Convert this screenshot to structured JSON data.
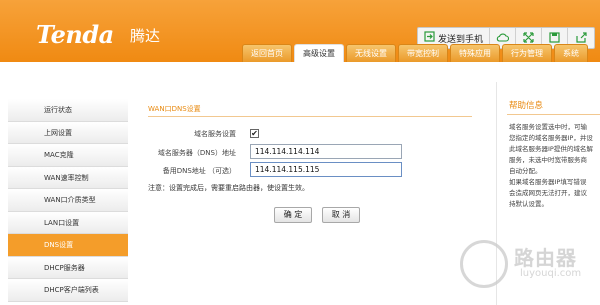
{
  "header": {
    "logo": "Tenda",
    "logo_cn": "腾达",
    "toolbar": {
      "send_label": "发送到手机",
      "icons": [
        "send-icon",
        "cloud-icon",
        "expand-icon",
        "save-icon",
        "share-icon"
      ]
    },
    "tabs": [
      {
        "label": "返回首页",
        "active": false
      },
      {
        "label": "高级设置",
        "active": true
      },
      {
        "label": "无线设置",
        "active": false
      },
      {
        "label": "带宽控制",
        "active": false
      },
      {
        "label": "特殊应用",
        "active": false
      },
      {
        "label": "行为管理",
        "active": false
      },
      {
        "label": "系统",
        "active": false
      }
    ]
  },
  "sidebar": {
    "items": [
      {
        "label": "运行状态"
      },
      {
        "label": "上网设置"
      },
      {
        "label": "MAC克隆"
      },
      {
        "label": "WAN速率控制"
      },
      {
        "label": "WAN口介质类型"
      },
      {
        "label": "LAN口设置"
      },
      {
        "label": "DNS设置",
        "active": true
      },
      {
        "label": "DHCP服务器"
      },
      {
        "label": "DHCP客户端列表"
      }
    ]
  },
  "main": {
    "title": "WAN口DNS设置",
    "rows": {
      "dns_service": {
        "label": "域名服务设置",
        "checked": "✔"
      },
      "primary": {
        "label": "域名服务器（DNS）地址",
        "value": "114.114.114.114"
      },
      "secondary": {
        "label": "备用DNS地址 （可选）",
        "value": "114.114.115.115"
      }
    },
    "note": "注意：设置完成后，需要重启路由器，使设置生效。",
    "ok_label": "确 定",
    "cancel_label": "取 消"
  },
  "help": {
    "title": "帮助信息",
    "lines": [
      "域名服务设置选中时，可输",
      "您指定的域名服务器IP，并设",
      "此域名服务器IP提供的域名解",
      "服务，未选中时宽带服务商",
      "自动分配。",
      "如果域名服务器IP填写错误",
      "会造成网页无法打开，建议",
      "持默认设置。"
    ]
  },
  "watermark": {
    "main": "路由器",
    "sub": "luyouqi.com"
  },
  "colors": {
    "accent": "#f08a12",
    "title": "#e88a10",
    "active_nav": "#f49d2a"
  }
}
